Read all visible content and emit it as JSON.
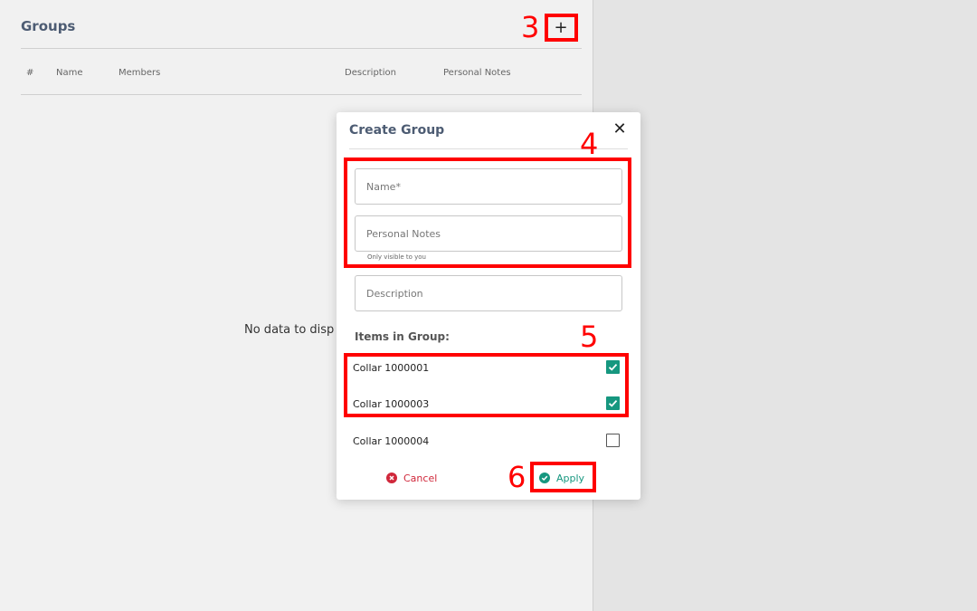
{
  "background": {
    "title": "Groups",
    "add_icon": "+",
    "columns": [
      "#",
      "Name",
      "Members",
      "Description",
      "Personal Notes"
    ],
    "empty_text": "No data to disp"
  },
  "modal": {
    "title": "Create Group",
    "close_icon": "✕",
    "name_placeholder": "Name*",
    "notes_placeholder": "Personal Notes",
    "notes_hint": "Only visible to you",
    "description_placeholder": "Description",
    "items_label": "Items in Group:",
    "items": [
      {
        "label": "Collar 1000001",
        "checked": true
      },
      {
        "label": "Collar 1000003",
        "checked": true
      },
      {
        "label": "Collar 1000004",
        "checked": false
      }
    ],
    "cancel_label": "Cancel",
    "apply_label": "Apply"
  },
  "annotations": [
    "3",
    "4",
    "5",
    "6"
  ],
  "colors": {
    "annotation": "#ff0000",
    "accent_teal": "#16977f",
    "danger_red": "#d0283b",
    "title_slate": "#4d5c73"
  }
}
